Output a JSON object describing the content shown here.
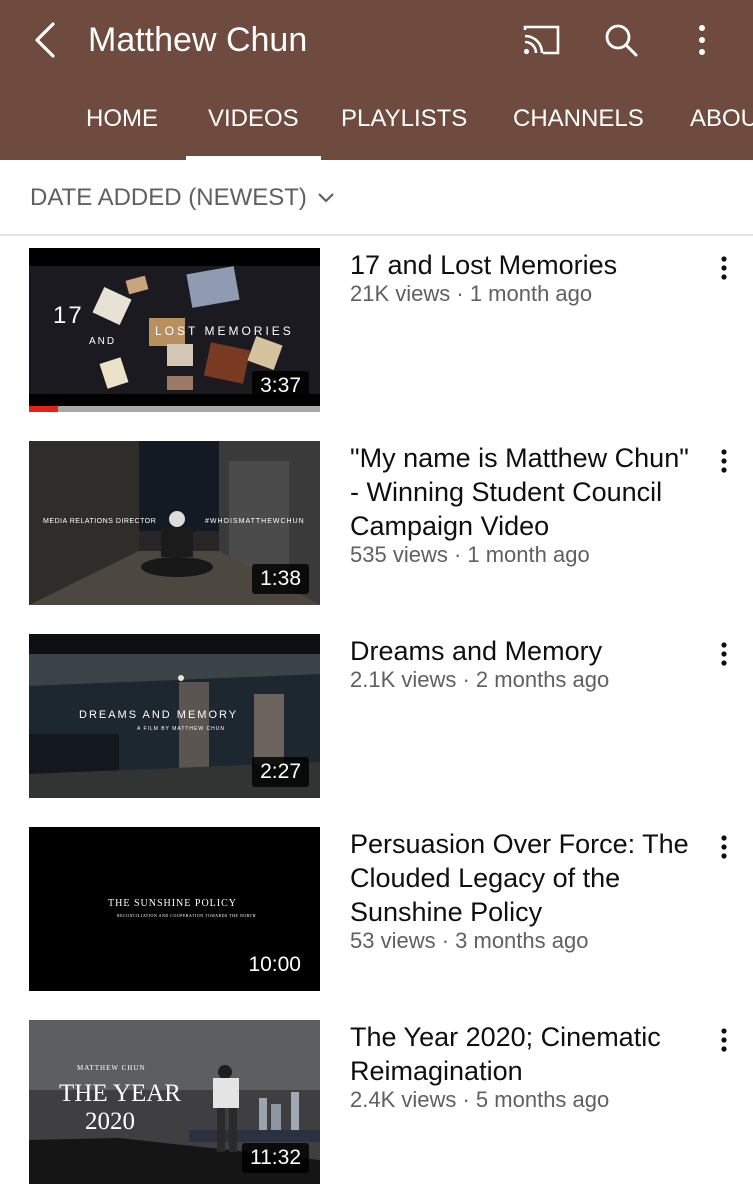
{
  "header": {
    "title": "Matthew Chun",
    "back_icon": "chevron-left-icon",
    "cast_icon": "cast-icon",
    "search_icon": "search-icon",
    "more_icon": "more-vert-icon",
    "background": "#6f4a3e"
  },
  "tabs": [
    {
      "label": "HOME",
      "active": false
    },
    {
      "label": "VIDEOS",
      "active": true
    },
    {
      "label": "PLAYLISTS",
      "active": false
    },
    {
      "label": "CHANNELS",
      "active": false
    },
    {
      "label": "ABOU",
      "active": false
    }
  ],
  "sort": {
    "label": "DATE ADDED (NEWEST)",
    "icon": "chevron-down-icon"
  },
  "videos": [
    {
      "title": "17 and Lost Memories",
      "meta": "21K views · 1 month ago",
      "duration": "3:37",
      "watched_fraction": 0.1,
      "overlay": {
        "line1": "17",
        "line2": "AND",
        "line3": "LOST MEMORIES"
      }
    },
    {
      "title": "\"My name is Matthew Chun\" - Winning Student Council Campaign Video",
      "meta": "535 views · 1 month ago",
      "duration": "1:38",
      "overlay": {
        "left": "MEDIA RELATIONS DIRECTOR",
        "right": "#WHOISMATTHEWCHUN"
      }
    },
    {
      "title": "Dreams and Memory",
      "meta": "2.1K views · 2 months ago",
      "duration": "2:27",
      "overlay": {
        "main": "DREAMS AND MEMORY",
        "sub": "A FILM BY MATTHEW CHUN"
      }
    },
    {
      "title": "Persuasion Over Force: The Clouded Legacy of the Sunshine Policy",
      "meta": "53 views · 3 months ago",
      "duration": "10:00",
      "overlay": {
        "main": "THE SUNSHINE POLICY",
        "sub": "RECONCILIATION AND COOPERATION TOWARDS THE NORTH"
      }
    },
    {
      "title": "The Year 2020; Cinematic Reimagination",
      "meta": "2.4K views · 5 months ago",
      "duration": "11:32",
      "overlay": {
        "top": "MATTHEW CHUN",
        "main": "THE YEAR",
        "year": "2020"
      }
    }
  ]
}
